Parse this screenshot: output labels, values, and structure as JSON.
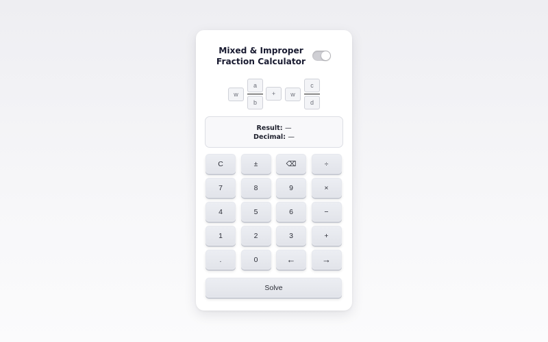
{
  "header": {
    "title_line1": "Mixed & Improper",
    "title_line2": "Fraction Calculator",
    "toggle_on": true
  },
  "fraction_input": {
    "first": {
      "whole": "w",
      "numerator": "a",
      "denominator": "b"
    },
    "operator": "+",
    "second": {
      "whole": "w",
      "numerator": "c",
      "denominator": "d"
    }
  },
  "display": {
    "result_label": "Result:",
    "result_value": "—",
    "decimal_label": "Decimal:",
    "decimal_value": "—"
  },
  "keypad": {
    "keys": [
      "C",
      "±",
      "⌫",
      "÷",
      "7",
      "8",
      "9",
      "×",
      "4",
      "5",
      "6",
      "−",
      "1",
      "2",
      "3",
      "+",
      ".",
      "0",
      "←",
      "→"
    ]
  },
  "solve_label": "Solve",
  "colors": {
    "title": "#181a30",
    "key_bg": "#e6e8ee",
    "toggle_track": "#cfcfd4"
  }
}
